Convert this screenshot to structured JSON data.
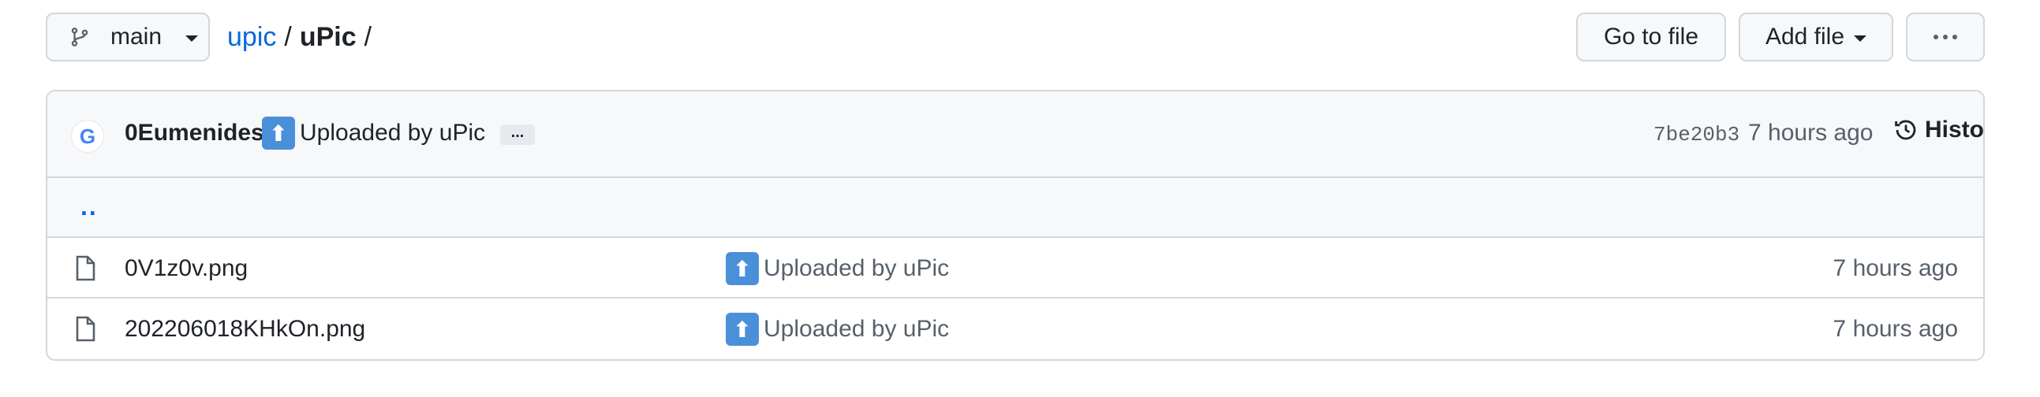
{
  "toolbar": {
    "branch": "main",
    "breadcrumb": {
      "repo": "upic",
      "sep1": "/",
      "folder": "uPic",
      "sep2": "/"
    },
    "goto_file": "Go to file",
    "add_file": "Add file"
  },
  "commit": {
    "avatar_letter": "G",
    "author": "0Eumenides",
    "emoji": "⬆",
    "message": "Uploaded by uPic",
    "more": "...",
    "sha": "7be20b3",
    "time": "7 hours ago",
    "history": "History"
  },
  "parent_link": "..",
  "files": [
    {
      "name": "0V1z0v.png",
      "emoji": "⬆",
      "message": "Uploaded by uPic",
      "time": "7 hours ago"
    },
    {
      "name": "202206018KHkOn.png",
      "emoji": "⬆",
      "message": "Uploaded by uPic",
      "time": "7 hours ago"
    }
  ],
  "colors": {
    "link": "#0969da",
    "border": "#d0d7de",
    "header_bg": "#f6f8fa",
    "muted": "#57606a"
  },
  "icons": [
    "branch-icon",
    "caret-down-icon",
    "kebab-icon",
    "google-avatar",
    "upload-emoji",
    "history-icon",
    "file-icon"
  ]
}
